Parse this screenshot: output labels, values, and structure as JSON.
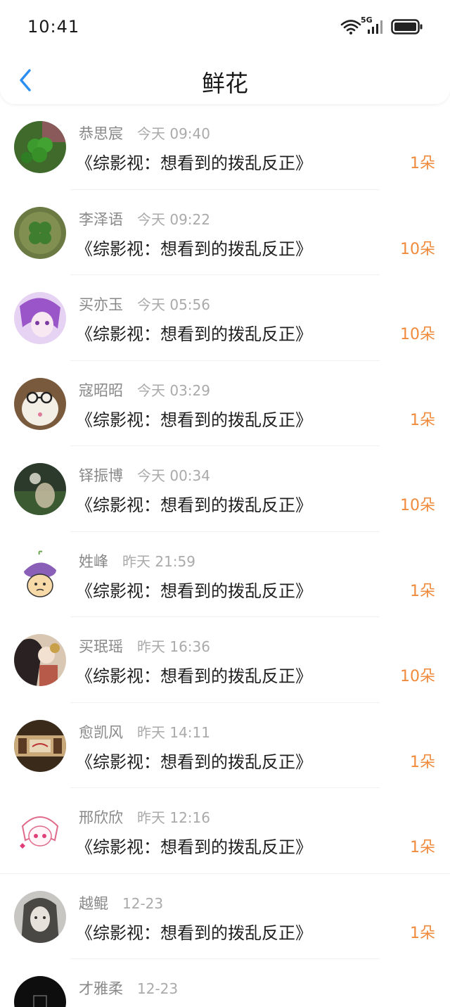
{
  "status_bar": {
    "time": "10:41",
    "network": "5G"
  },
  "header": {
    "title": "鲜花"
  },
  "colors": {
    "accent": "#2b8ef0",
    "count": "#f08a3c"
  },
  "items": [
    {
      "name": "恭思宸",
      "time": "今天 09:40",
      "title": "《综影视：想看到的拨乱反正》",
      "count": "1朵"
    },
    {
      "name": "李泽语",
      "time": "今天 09:22",
      "title": "《综影视：想看到的拨乱反正》",
      "count": "10朵"
    },
    {
      "name": "买亦玉",
      "time": "今天 05:56",
      "title": "《综影视：想看到的拨乱反正》",
      "count": "10朵"
    },
    {
      "name": "寇昭昭",
      "time": "今天 03:29",
      "title": "《综影视：想看到的拨乱反正》",
      "count": "1朵"
    },
    {
      "name": "铎振博",
      "time": "今天 00:34",
      "title": "《综影视：想看到的拨乱反正》",
      "count": "10朵"
    },
    {
      "name": "姓峰",
      "time": "昨天 21:59",
      "title": "《综影视：想看到的拨乱反正》",
      "count": "1朵"
    },
    {
      "name": "买珉瑶",
      "time": "昨天 16:36",
      "title": "《综影视：想看到的拨乱反正》",
      "count": "10朵"
    },
    {
      "name": "愈凯风",
      "time": "昨天 14:11",
      "title": "《综影视：想看到的拨乱反正》",
      "count": "1朵"
    },
    {
      "name": "邢欣欣",
      "time": "昨天 12:16",
      "title": "《综影视：想看到的拨乱反正》",
      "count": "1朵"
    },
    {
      "name": "越鲲",
      "time": "12-23",
      "title": "《综影视：想看到的拨乱反正》",
      "count": "1朵"
    },
    {
      "name": "才雅柔",
      "time": "12-23",
      "title": "",
      "count": ""
    }
  ]
}
